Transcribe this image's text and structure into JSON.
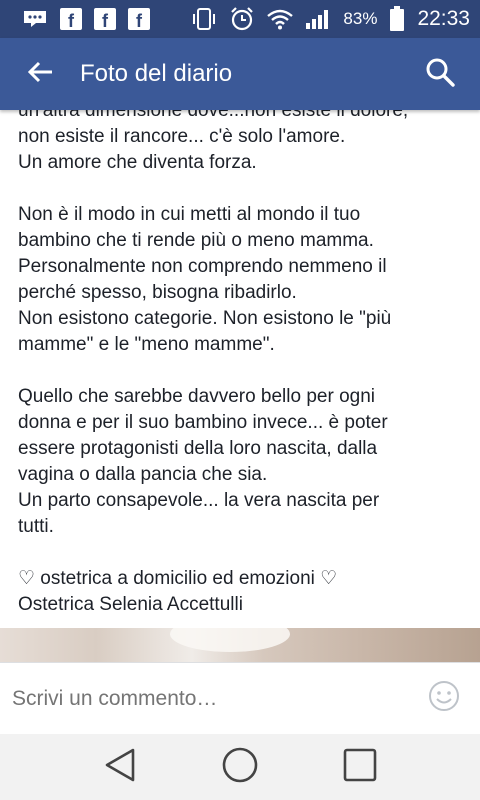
{
  "status_bar": {
    "battery": "83%",
    "time": "22:33",
    "icons": [
      "messenger-icon",
      "facebook-icon",
      "facebook-icon",
      "facebook-icon",
      "vibrate-icon",
      "alarm-icon",
      "wifi-icon",
      "signal-icon",
      "battery-icon"
    ]
  },
  "app_bar": {
    "title": "Foto del diario",
    "back_icon": "arrow-back-icon",
    "search_icon": "search-icon"
  },
  "post": {
    "lines": [
      "un'altra dimensione dove...non esiste il dolore,",
      "non esiste il rancore... c'è solo l'amore.",
      "Un amore che diventa forza.",
      "",
      "Non è il modo in cui metti al mondo il tuo",
      "bambino che ti rende più o meno mamma.",
      "Personalmente non comprendo nemmeno il",
      "perché spesso, bisogna ribadirlo.",
      "Non esistono categorie. Non esistono le \"più",
      "mamme\" e le \"meno mamme\".",
      "",
      "Quello che sarebbe davvero bello per ogni",
      "donna e per il suo bambino invece... è poter",
      "essere protagonisti della loro nascita, dalla",
      "vagina o dalla pancia che sia.",
      "Un parto consapevole... la vera nascita per",
      "tutti.",
      "",
      "♡ ostetrica a domicilio ed emozioni ♡",
      "Ostetrica Selenia Accettulli"
    ]
  },
  "comment": {
    "placeholder": "Scrivi un commento…",
    "emoji_icon": "smiley-icon"
  },
  "nav": {
    "icons": [
      "back-triangle-icon",
      "home-circle-icon",
      "recents-square-icon"
    ]
  },
  "colors": {
    "status_bar": "#2f4577",
    "app_bar": "#3b5998",
    "text": "#1d2129",
    "placeholder": "#8d949e"
  }
}
